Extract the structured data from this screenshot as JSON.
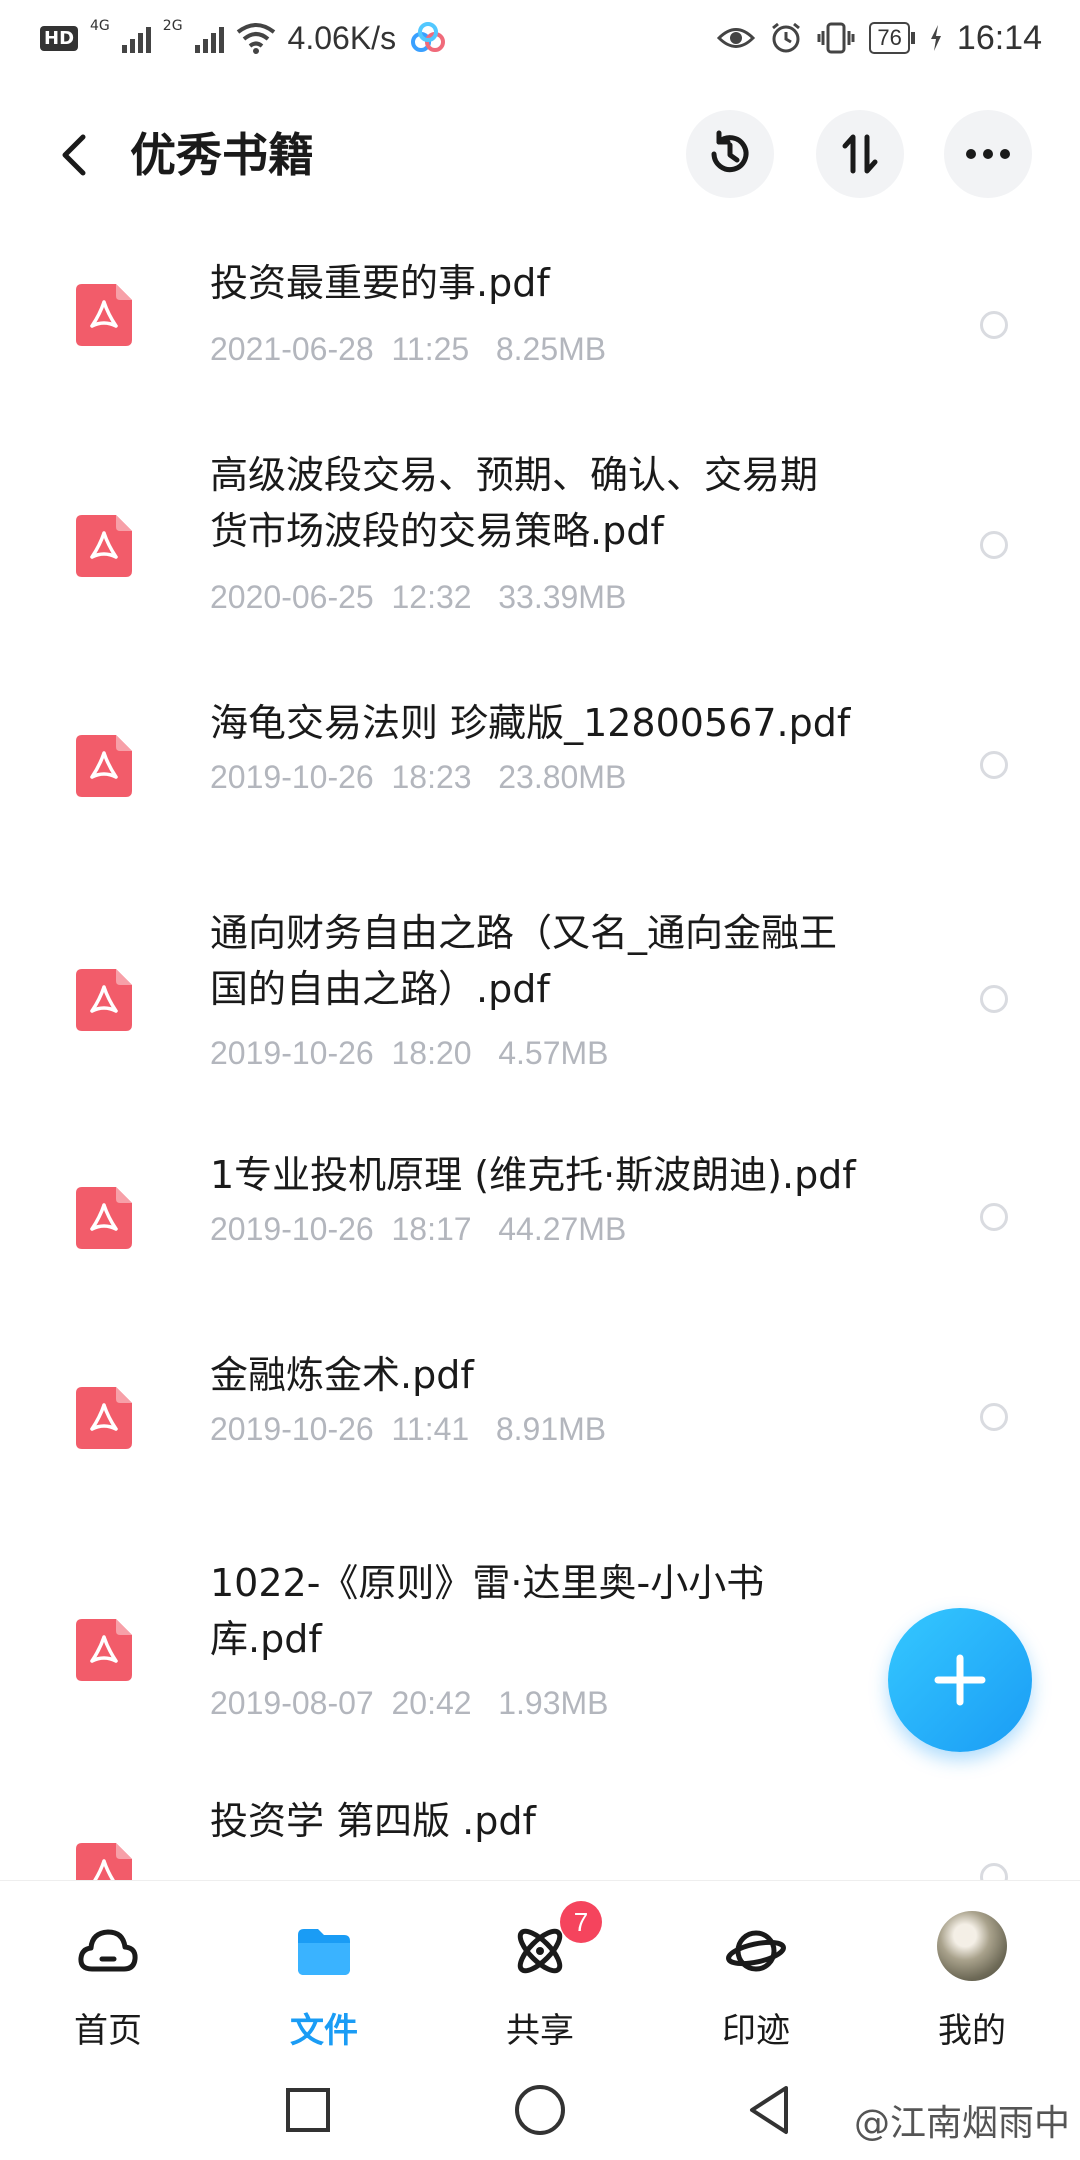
{
  "status_bar": {
    "hd": "HD",
    "network_4g": "4G",
    "network_2g": "2G",
    "speed": "4.06K/s",
    "battery": "76",
    "time": "16:14"
  },
  "header": {
    "title": "优秀书籍"
  },
  "files": [
    {
      "name": "投资最重要的事.pdf",
      "meta": "2021-06-28  11:25   8.25MB"
    },
    {
      "name": "高级波段交易、预期、确认、交易期\n货市场波段的交易策略.pdf",
      "meta": "2020-06-25  12:32   33.39MB"
    },
    {
      "name": "海龟交易法则 珍藏版_12800567.pdf",
      "meta": "2019-10-26  18:23   23.80MB"
    },
    {
      "name": "通向财务自由之路（又名_通向金融王\n国的自由之路）.pdf",
      "meta": "2019-10-26  18:20   4.57MB"
    },
    {
      "name": "1专业投机原理 (维克托·斯波朗迪).pdf",
      "meta": "2019-10-26  18:17   44.27MB"
    },
    {
      "name": "金融炼金术.pdf",
      "meta": "2019-10-26  11:41   8.91MB"
    },
    {
      "name": "1022-《原则》雷·达里奥-小小书\n库.pdf",
      "meta": "2019-08-07  20:42   1.93MB"
    },
    {
      "name": "投资学 第四版 .pdf",
      "meta": ""
    }
  ],
  "bottom_nav": {
    "items": [
      {
        "label": "首页"
      },
      {
        "label": "文件"
      },
      {
        "label": "共享",
        "badge": "7"
      },
      {
        "label": "印迹"
      },
      {
        "label": "我的"
      }
    ],
    "active": "文件"
  },
  "watermark": "@江南烟雨中",
  "colors": {
    "accent": "#1a9cf5",
    "pdf_red": "#f25c6a",
    "meta_gray": "#b3b6bd",
    "badge_red": "#f5445d"
  }
}
